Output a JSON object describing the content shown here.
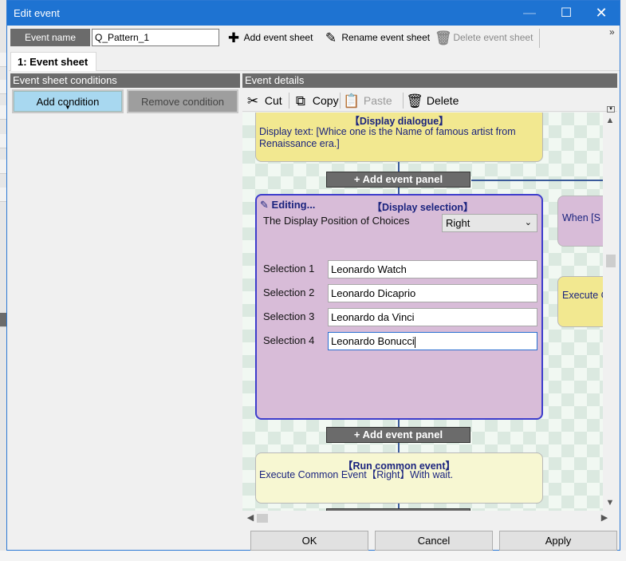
{
  "window": {
    "title": "Edit event",
    "minimize_glyph": "—",
    "maximize_glyph": "☐",
    "close_glyph": "✕"
  },
  "toolbar": {
    "event_name_label": "Event name",
    "event_name_value": "Q_Pattern_1",
    "add_sheet_label": "Add event sheet",
    "rename_sheet_label": "Rename event sheet",
    "delete_sheet_label": "Delete event sheet",
    "more_glyph": "»"
  },
  "tabs": [
    {
      "label": "1: Event sheet",
      "active": true
    }
  ],
  "conditions_panel": {
    "header": "Event sheet conditions",
    "add_label": "Add condition",
    "remove_label": "Remove condition"
  },
  "details_panel": {
    "header": "Event details",
    "cut_label": "Cut",
    "copy_label": "Copy",
    "paste_label": "Paste",
    "delete_label": "Delete"
  },
  "events": {
    "dialogue": {
      "title": "【Display dialogue】",
      "body": "Display text: [Whice one is the Name of famous artist from Renaissance era.]"
    },
    "add_panel_label": "+ Add event panel",
    "selection": {
      "editing_label": "Editing...",
      "title": "【Display selection】",
      "position_label": "The Display Position of Choices",
      "position_value": "Right",
      "choices": [
        {
          "label": "Selection 1",
          "value": "Leonardo Watch"
        },
        {
          "label": "Selection 2",
          "value": "Leonardo Dicaprio"
        },
        {
          "label": "Selection 3",
          "value": "Leonardo da Vinci"
        },
        {
          "label": "Selection 4",
          "value": "Leonardo Bonucci"
        }
      ]
    },
    "run_common": {
      "title": "【Run common event】",
      "body": "Execute Common Event【Right】With wait."
    },
    "side_cards": [
      "When [S",
      "Execute C"
    ]
  },
  "footer": {
    "ok_label": "OK",
    "cancel_label": "Cancel",
    "apply_label": "Apply"
  },
  "colors": {
    "titlebar": "#1e73d2",
    "panel_header": "#6b6b6b",
    "dialogue_card": "#f2e890",
    "selection_card": "#d8bcd8",
    "run_card": "#f7f7d2",
    "add_condition": "#a8d8f0",
    "event_text": "#1a237e"
  }
}
